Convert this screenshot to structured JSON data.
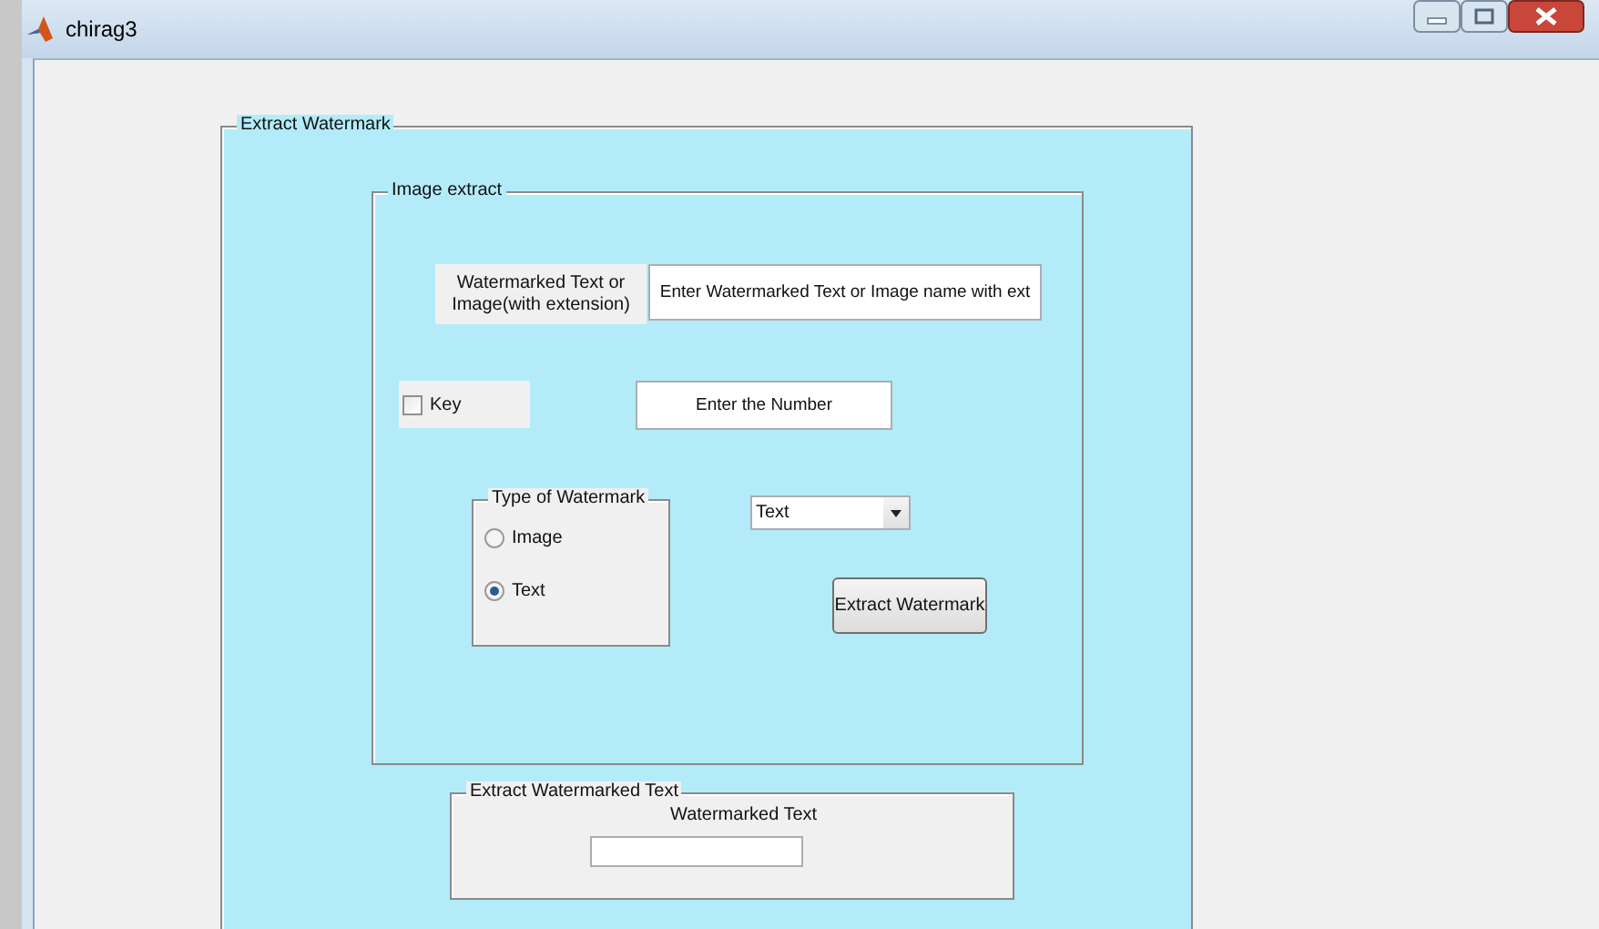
{
  "window": {
    "title": "chirag3"
  },
  "panel": {
    "title": "Extract Watermark",
    "image_extract": {
      "title": "Image extract",
      "input_label": "Watermarked Text or Image(with extension)",
      "input": {
        "value": "Enter Watermarked Text or Image name with ext"
      },
      "key_checkbox": {
        "label": "Key",
        "checked": false
      },
      "number_field": {
        "value": "Enter the Number"
      },
      "type_group": {
        "title": "Type of Watermark",
        "options": [
          {
            "label": "Image",
            "selected": false
          },
          {
            "label": "Text",
            "selected": true
          }
        ]
      },
      "dropdown": {
        "value": "Text"
      },
      "button": "Extract Watermark"
    },
    "result": {
      "title": "Extract Watermarked Text",
      "label": "Watermarked Text"
    }
  }
}
